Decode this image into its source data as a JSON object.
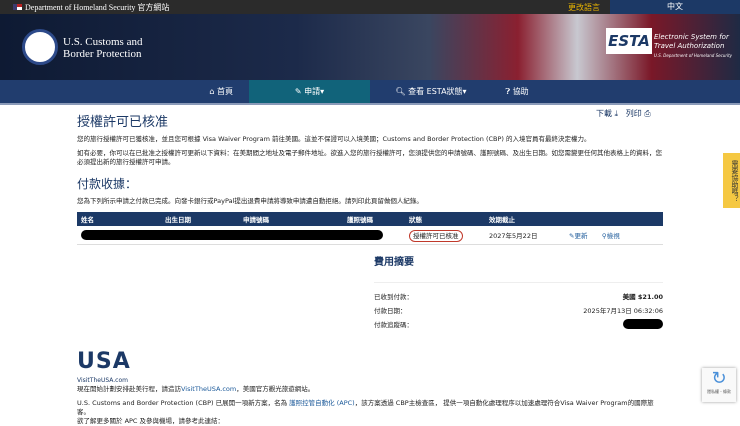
{
  "topbar": {
    "agency": "Department of Homeland Security 官方網站",
    "change_language": "更改語言",
    "language": "中文"
  },
  "header": {
    "cbp_line1": "U.S. Customs and",
    "cbp_line2": "Border Protection",
    "esta_logo": "ESTA",
    "esta_line1": "Electronic System for",
    "esta_line2": "Travel Authorization",
    "esta_line3": "U.S. Department of Homeland Security"
  },
  "nav": {
    "home": "首頁",
    "apply": "申請",
    "check": "查看 ESTA狀態",
    "help": "協助"
  },
  "page": {
    "title": "授權許可已核准",
    "download": "下載",
    "print": "列印",
    "para1": "您的旅行授權許可已獲核准，並且您可根據 Visa Waiver Program 前往美國。這並不保證可以入境美國；Customs and Border Protection (CBP) 的入境官員有最終決定權力。",
    "para2": "如有必要，你可以在已批准之授權許可更新以下資料：在美期間之地址及電子郵件地址。欲進入您的旅行授權許可，您須提供您的申請號碼、護照號碼、及出生日期。如您需變更任何其他表格上的資料，您必須提出新的旅行授權許可申請。",
    "receipt_title": "付款收據：",
    "receipt_text": "您為下列所示申請之付款已完成。向發卡銀行或PayPal提出退費申請將導致申請遭自動拒絕。請列印此頁留做個人紀錄。"
  },
  "table": {
    "headers": [
      "姓名",
      "出生日期",
      "申請號碼",
      "護照號碼",
      "狀態",
      "效期截止"
    ],
    "row": {
      "status": "授權許可已核准",
      "expiry": "2027年5月22日",
      "update": "更新",
      "view": "檢視"
    }
  },
  "fees": {
    "title": "費用摘要",
    "received_label": "已收到付款：",
    "received": "美國 $21.00",
    "date_label": "付款日期：",
    "date": "2025年7月13日 06:32:06",
    "tracking_label": "付款追蹤碼："
  },
  "footer": {
    "usa_logo": "USA",
    "visit_caption": "VisitTheUSA.com",
    "visit_pre": "現在開始計劃安排赴美行程，請造訪",
    "visit_link": "VisitTheUSA.com",
    "visit_post": "，美國官方觀光旅遊網站。",
    "apc_pre": "U.S. Customs and Border Protection (CBP) 已展開一項新方案，名為 ",
    "apc_link": "護照控管自動化 (APC)",
    "apc_post": "，該方案透過 CBP主檢查區， 提供一項自動化處理程序以加速處理符合Visa Waiver Program的國際旅客。",
    "apc_more": "欲了解更多關於 APC 及參與機場，請參考此連結："
  },
  "feedback": "需要協助嗎？",
  "captcha": "隱私權 - 條款"
}
